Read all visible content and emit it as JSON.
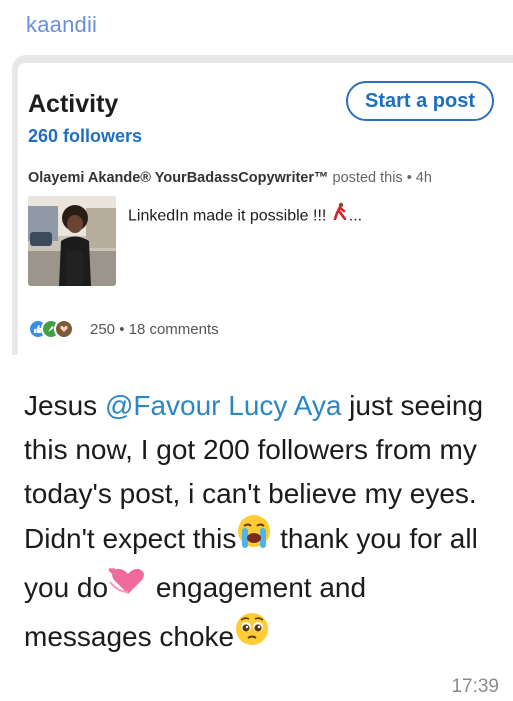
{
  "sender": "kaandii",
  "card": {
    "title": "Activity",
    "followers": "260 followers",
    "start_post": "Start a post",
    "author": "Olayemi Akande® YourBadassCopywriter™",
    "posted_suffix": "posted this • 4h",
    "post_text": "LinkedIn made it possible !!! ",
    "post_ellipsis": "...",
    "reaction_stats": "250 • 18 comments"
  },
  "message": {
    "part1": "Jesus ",
    "mention": "@Favour Lucy Aya",
    "part2": "  just seeing this now, I got 200 followers from my today's post, i can't believe my eyes. Didn't expect this",
    "part3": " thank you for all you do",
    "part4": " engagement and messages choke"
  },
  "time": "17:39",
  "colors": {
    "sender": "#6a8fd6",
    "link_blue": "#1f6fc0",
    "mention": "#2b86c5"
  },
  "icons": [
    "loudly-crying-emoji",
    "revolving-hearts-emoji",
    "pleading-face-emoji",
    "dancer-emoji",
    "like-reaction-icon",
    "celebrate-reaction-icon",
    "support-reaction-icon"
  ]
}
